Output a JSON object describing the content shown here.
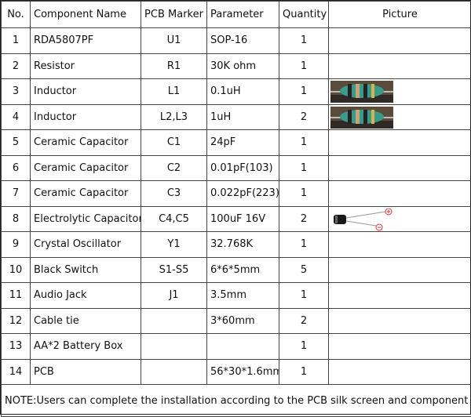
{
  "headers": {
    "no": "No.",
    "name": "Component Name",
    "marker": "PCB Marker",
    "parameter": "Parameter",
    "quantity": "Quantity",
    "picture": "Picture"
  },
  "rows": [
    {
      "no": "1",
      "name": "RDA5807PF",
      "marker": "U1",
      "parameter": "SOP-16",
      "quantity": "1"
    },
    {
      "no": "2",
      "name": "Resistor",
      "marker": "R1",
      "parameter": "30K ohm",
      "quantity": "1"
    },
    {
      "no": "3",
      "name": "Inductor",
      "marker": "L1",
      "parameter": "0.1uH",
      "quantity": "1",
      "picture": "inductor-photo"
    },
    {
      "no": "4",
      "name": "Inductor",
      "marker": "L2,L3",
      "parameter": "1uH",
      "quantity": "2",
      "picture": "inductor-photo"
    },
    {
      "no": "5",
      "name": "Ceramic Capacitor",
      "marker": "C1",
      "parameter": "24pF",
      "quantity": "1"
    },
    {
      "no": "6",
      "name": "Ceramic Capacitor",
      "marker": "C2",
      "parameter": "0.01pF(103)",
      "quantity": "1"
    },
    {
      "no": "7",
      "name": "Ceramic Capacitor",
      "marker": "C3",
      "parameter": "0.022pF(223)",
      "quantity": "1"
    },
    {
      "no": "8",
      "name": "Electrolytic Capacitor",
      "marker": "C4,C5",
      "parameter": "100uF 16V",
      "quantity": "2",
      "picture": "electrolytic-capacitor-photo"
    },
    {
      "no": "9",
      "name": "Crystal Oscillator",
      "marker": "Y1",
      "parameter": "32.768K",
      "quantity": "1"
    },
    {
      "no": "10",
      "name": "Black Switch",
      "marker": "S1-S5",
      "parameter": "6*6*5mm",
      "quantity": "5"
    },
    {
      "no": "11",
      "name": "Audio Jack",
      "marker": "J1",
      "parameter": "3.5mm",
      "quantity": "1"
    },
    {
      "no": "12",
      "name": "Cable tie",
      "marker": "",
      "parameter": "3*60mm",
      "quantity": "2"
    },
    {
      "no": "13",
      "name": "AA*2 Battery Box",
      "marker": "",
      "parameter": "",
      "quantity": "1"
    },
    {
      "no": "14",
      "name": "PCB",
      "marker": "",
      "parameter": "56*30*1.6mm",
      "quantity": "1"
    }
  ],
  "note": "NOTE:Users can complete the installation according to the PCB silk screen and component list."
}
